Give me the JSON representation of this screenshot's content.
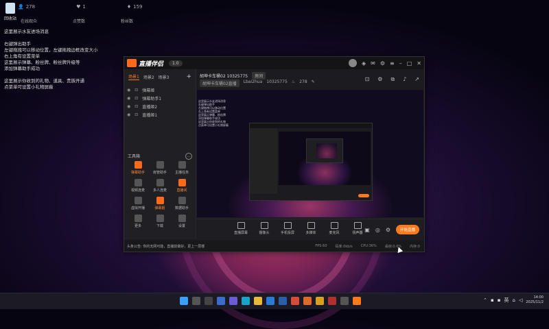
{
  "desktop": {
    "recycle_label": "回收站",
    "stats": [
      {
        "icon": "person-icon",
        "value": "278"
      },
      {
        "icon": "heart-icon",
        "value": "1"
      },
      {
        "icon": "gift-icon",
        "value": "159"
      }
    ],
    "subheads": [
      "在线观众",
      "点赞数",
      "粉丝数"
    ],
    "notes": [
      "这里展示水友进场消息",
      "",
      "右键弹出助手",
      "左键拖拽可以移动位置，左键拖拽边框改变大小",
      "右上角有设置菜单",
      "这里展示弹幕、粉丝牌、粉丝牌升级等",
      "添加弹幕助手成功",
      "",
      "这里展示你收到的礼物、道具、贵族开通",
      "点菜单可设置小礼物屏蔽"
    ]
  },
  "app": {
    "brand": "直播伴侣",
    "version": "1.0",
    "scene_tabs": [
      "场景1",
      "场景2",
      "场景3"
    ],
    "scene_plus": "+",
    "sources": [
      {
        "name": "弹幕姬"
      },
      {
        "name": "弹幕助手1"
      },
      {
        "name": "直播姬2"
      },
      {
        "name": "直播姬1"
      }
    ],
    "tools_title": "工具箱",
    "tools_more": "…",
    "tools": [
      {
        "label": "弹幕助手",
        "hot": true
      },
      {
        "label": "房管助手",
        "hot": false
      },
      {
        "label": "主播任务",
        "hot": false
      },
      {
        "label": "视频连麦",
        "hot": false
      },
      {
        "label": "多人连麦",
        "hot": false
      },
      {
        "label": "直播间",
        "hot": true
      },
      {
        "label": "虚拟开播",
        "hot": false
      },
      {
        "label": "弹幕姬",
        "hot": true
      },
      {
        "label": "数据助手",
        "hot": false
      },
      {
        "label": "更多",
        "hot": false
      },
      {
        "label": "下载",
        "hot": false
      },
      {
        "label": "设置",
        "hot": false
      }
    ],
    "room_title": "胡坤卡车桶02 10325775",
    "room_tag": "房间",
    "room_category": "胡坤卡车桶02直播",
    "room_user": "Lbai2hua",
    "room_id": "10325775",
    "room_heat": "278",
    "preview_text": [
      "这里展示水友进场消息",
      "",
      "右键弹出助手",
      "左键拖拽可以移动位置",
      "右上角有设置菜单",
      "这里展示弹幕、粉丝牌",
      "添加弹幕助手成功",
      "",
      "这里展示你收到的礼物",
      "点菜单可设置小礼物屏蔽"
    ],
    "bottom_items": [
      "直播屏幕",
      "摄像头",
      "手机投屏",
      "多媒体",
      "麦克风",
      "扬声器"
    ],
    "go_live": "开始直播",
    "status_notice": "头条公告: 你的无网可能，直播前做好，更上一层楼",
    "status_stats": [
      "FPS:60",
      "码率:0kb/s",
      "CPU:36%",
      "丢帧:0.0%",
      "内存:0"
    ]
  },
  "taskbar": {
    "lang": "英",
    "time": "14:00",
    "date": "2025/11/2"
  }
}
